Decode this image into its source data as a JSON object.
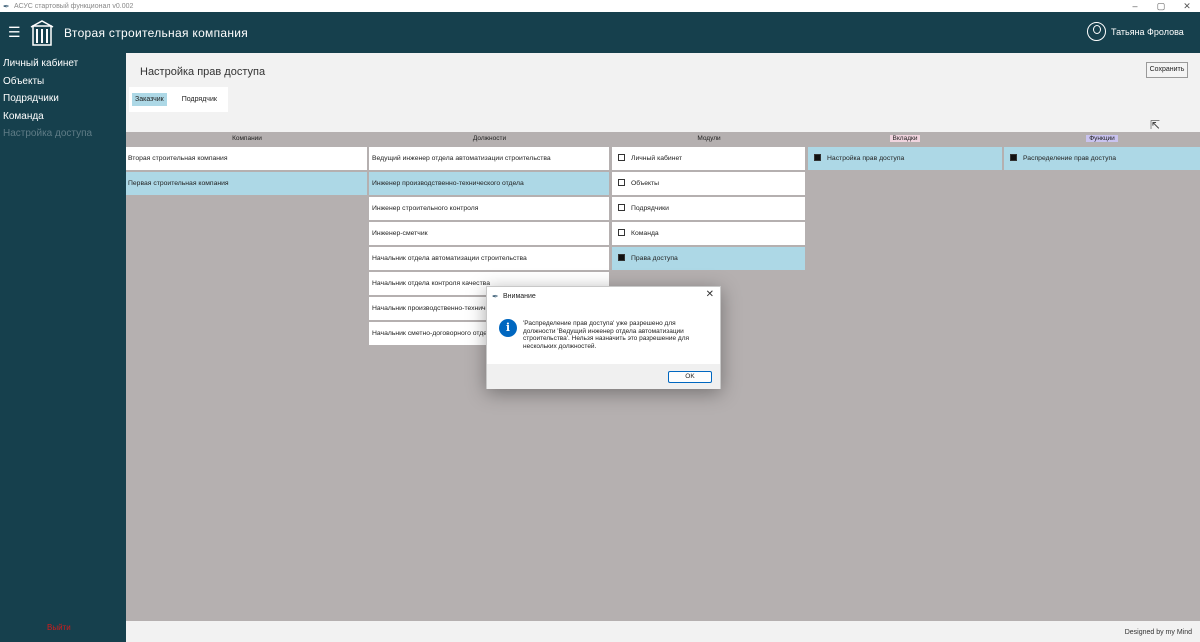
{
  "window": {
    "title": "АСУС стартовый функционал v0.002",
    "controls": [
      "–",
      "▢",
      "✕"
    ]
  },
  "header": {
    "menu_icon": "☰",
    "company_name": "Вторая строительная компания",
    "user_name": "Татьяна Фролова"
  },
  "sidebar": {
    "items": [
      {
        "label": "Личный кабинет"
      },
      {
        "label": "Объекты"
      },
      {
        "label": "Подрядчики"
      },
      {
        "label": "Команда"
      },
      {
        "label": "Настройка доступа"
      }
    ],
    "exit_label": "Выйти"
  },
  "main": {
    "page_title": "Настройка прав доступа",
    "save_label": "Сохранить",
    "tabs": [
      {
        "label": "Заказчик",
        "active": true
      },
      {
        "label": "Подрядчик",
        "active": false
      }
    ],
    "columns": [
      "Компании",
      "Должности",
      "Модули",
      "Вкладки",
      "Функции"
    ],
    "companies": [
      {
        "name": "Вторая строительная компания",
        "selected": false
      },
      {
        "name": "Первая строительная компания",
        "selected": true
      }
    ],
    "positions": [
      {
        "name": "Ведущий инженер отдела автоматизации строительства",
        "selected": false
      },
      {
        "name": "Инженер производственно-технического отдела",
        "selected": true
      },
      {
        "name": "Инженер строительного контроля",
        "selected": false
      },
      {
        "name": "Инженер-сметчик",
        "selected": false
      },
      {
        "name": "Начальник отдела автоматизации строительства",
        "selected": false
      },
      {
        "name": "Начальник отдела контроля качества",
        "selected": false
      },
      {
        "name": "Начальник производственно-технического отдела",
        "selected": false
      },
      {
        "name": "Начальник сметно-договорного отдела",
        "selected": false
      }
    ],
    "modules": [
      {
        "name": "Личный кабинет",
        "checked": false,
        "selected": false
      },
      {
        "name": "Объекты",
        "checked": false,
        "selected": false
      },
      {
        "name": "Подрядчики",
        "checked": false,
        "selected": false
      },
      {
        "name": "Команда",
        "checked": false,
        "selected": false
      },
      {
        "name": "Права доступа",
        "checked": true,
        "selected": true
      }
    ],
    "tabs_column": [
      {
        "name": "Настройка прав доступа",
        "checked": true
      }
    ],
    "functions": [
      {
        "name": "Распределение прав доступа",
        "checked": true
      }
    ],
    "footer_text": "Designed by my Mind"
  },
  "dialog": {
    "title": "Внимание",
    "message": "'Распределение прав доступа' уже разрешено для должности 'Ведущий инженер отдела автоматизации строительства'. Нельзя назначить это разрешение для нескольких должностей.",
    "ok_label": "OK",
    "close_icon": "✕"
  },
  "colors": {
    "sidebar": "#16404d",
    "selected": "#add8e6",
    "workspace": "#b5b0b0",
    "exit": "#d01c1c"
  }
}
